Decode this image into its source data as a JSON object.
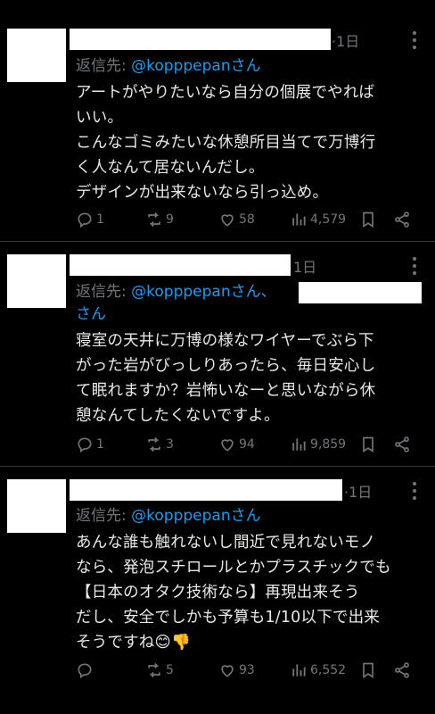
{
  "tweets": [
    {
      "time": "·1日",
      "reply_prefix": "返信先: ",
      "reply_handle": "@kopppepanさん",
      "reply_handle_2": "",
      "text": "アートがやりたいなら自分の個展でやれば\nいい。\nこんなゴミみたいな休憩所目当てで万博行\nく人なんて居ないんだし。\nデザインが出来ないなら引っ込め。",
      "replies": "1",
      "reposts": "9",
      "likes": "58",
      "views": "4,579"
    },
    {
      "time": "1日",
      "reply_prefix": "返信先: ",
      "reply_handle": "@kopppepanさん、",
      "reply_handle_2": "さん",
      "text": "寝室の天井に万博の様なワイヤーでぶら下\nがった岩がびっしりあったら、毎日安心し\nて眠れますか？岩怖いなーと思いながら休\n憩なんてしたくないですよ。",
      "replies": "1",
      "reposts": "3",
      "likes": "94",
      "views": "9,859"
    },
    {
      "time": "·1日",
      "reply_prefix": "返信先: ",
      "reply_handle": "@kopppepanさん",
      "reply_handle_2": "",
      "text": "あんな誰も触れないし間近で見れないモノ\nなら、発泡スチロールとかプラスチックでも\n【日本のオタク技術なら】再現出来そう\nだし、安全でしかも予算も1/10以下で出来\nそうですね😊👎",
      "replies": "",
      "reposts": "5",
      "likes": "93",
      "views": "6,552"
    }
  ]
}
